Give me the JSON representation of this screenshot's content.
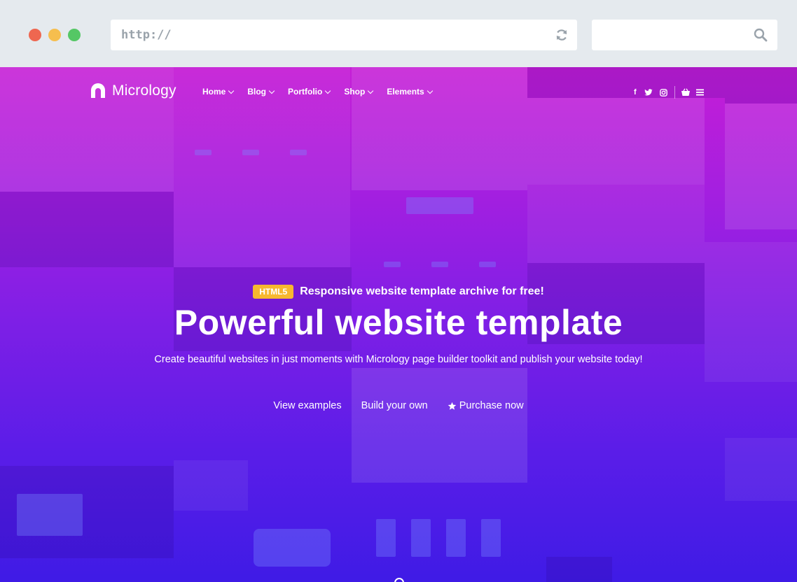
{
  "browser": {
    "url_text": "http://",
    "reload_icon": "reload-icon",
    "search_icon": "search-icon",
    "window_controls": [
      "close",
      "minimize",
      "maximize"
    ]
  },
  "site": {
    "logo_text": "Micrology",
    "nav": [
      {
        "label": "Home"
      },
      {
        "label": "Blog"
      },
      {
        "label": "Portfolio"
      },
      {
        "label": "Shop"
      },
      {
        "label": "Elements"
      }
    ],
    "social": {
      "facebook": "f",
      "twitter": "t",
      "instagram": "◎",
      "cart_icon": "cart-icon",
      "menu_icon": "menu-icon"
    }
  },
  "hero": {
    "badge": "HTML5",
    "tagline": "Responsive website template archive for free!",
    "headline": "Powerful website template",
    "subtext": "Create beautiful websites in just moments with Micrology page builder toolkit and publish your website today!",
    "ctas": {
      "view_examples": "View examples",
      "build_your_own": "Build your own",
      "purchase_now": "Purchase now"
    }
  },
  "colors": {
    "gradient_top": "#c61ed6",
    "gradient_bottom": "#3f1be6",
    "badge": "#f7b82f"
  }
}
